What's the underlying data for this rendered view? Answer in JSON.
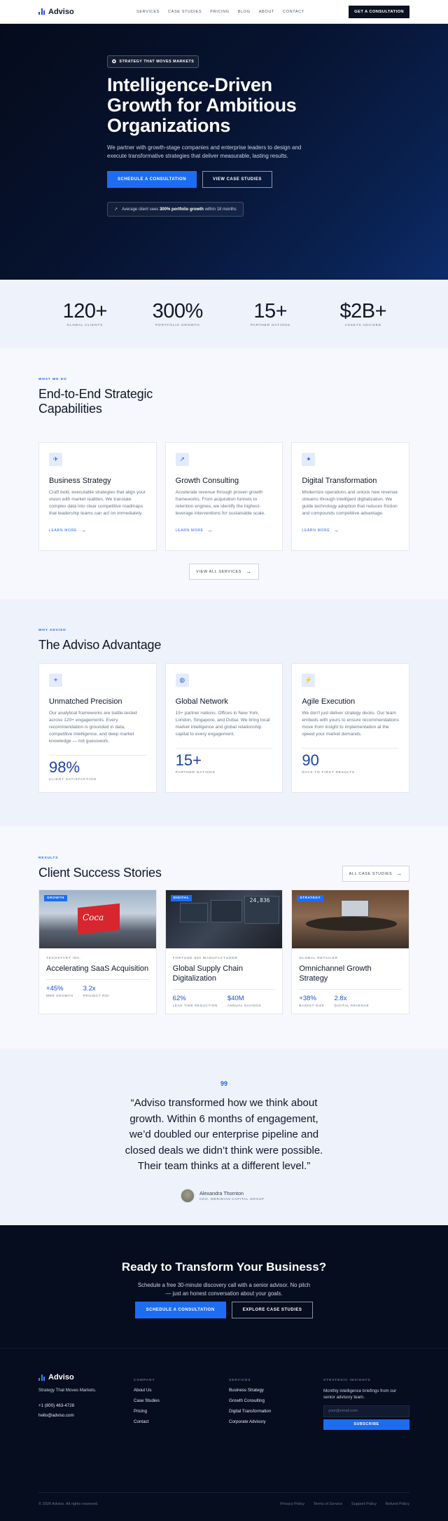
{
  "nav": {
    "brand": "Adviso",
    "links": [
      "SERVICES",
      "CASE STUDIES",
      "PRICING",
      "BLOG",
      "ABOUT",
      "CONTACT"
    ],
    "cta": "GET A CONSULTATION"
  },
  "hero": {
    "eyebrow": "STRATEGY THAT MOVES MARKETS",
    "title": "Intelligence-Driven Growth for Ambitious Organizations",
    "subtitle": "We partner with growth-stage companies and enterprise leaders to design and execute transformative strategies that deliver measurable, lasting results.",
    "primary_cta": "SCHEDULE A CONSULTATION",
    "secondary_cta": "VIEW CASE STUDIES",
    "note_prefix": "Average client sees ",
    "note_bold": "300% portfolio growth",
    "note_suffix": " within 18 months"
  },
  "stats": [
    {
      "value": "120+",
      "label": "GLOBAL CLIENTS"
    },
    {
      "value": "300%",
      "label": "PORTFOLIO GROWTH"
    },
    {
      "value": "15+",
      "label": "PARTNER NATIONS"
    },
    {
      "value": "$2B+",
      "label": "ASSETS ADVISED"
    }
  ],
  "services": {
    "eyebrow": "WHAT WE DO",
    "title": "End-to-End Strategic Capabilities",
    "cards": [
      {
        "icon": "rocket-icon",
        "title": "Business Strategy",
        "text": "Craft bold, executable strategies that align your vision with market realities. We translate complex data into clear competitive roadmaps that leadership teams can act on immediately.",
        "link": "LEARN MORE"
      },
      {
        "icon": "trend-icon",
        "title": "Growth Consulting",
        "text": "Accelerate revenue through proven growth frameworks. From acquisition funnels to retention engines, we identify the highest-leverage interventions for sustainable scale.",
        "link": "LEARN MORE"
      },
      {
        "icon": "sparkle-icon",
        "title": "Digital Transformation",
        "text": "Modernize operations and unlock new revenue streams through intelligent digitalization. We guide technology adoption that reduces friction and compounds competitive advantage.",
        "link": "LEARN MORE"
      }
    ],
    "view_all": "VIEW ALL SERVICES"
  },
  "advantage": {
    "eyebrow": "WHY ADVISO",
    "title": "The Adviso Advantage",
    "cards": [
      {
        "icon": "target-icon",
        "title": "Unmatched Precision",
        "text": "Our analytical frameworks are battle-tested across 120+ engagements. Every recommendation is grounded in data, competitive intelligence, and deep market knowledge — not guesswork.",
        "stat": "98%",
        "stat_label": "CLIENT SATISFACTION"
      },
      {
        "icon": "globe-icon",
        "title": "Global Network",
        "text": "15+ partner nations. Offices in New York, London, Singapore, and Dubai. We bring local market intelligence and global relationship capital to every engagement.",
        "stat": "15+",
        "stat_label": "PARTNER NATIONS"
      },
      {
        "icon": "bolt-icon",
        "title": "Agile Execution",
        "text": "We don't just deliver strategy decks. Our team embeds with yours to ensure recommendations move from insight to implementation at the speed your market demands.",
        "stat": "90",
        "stat_label": "DAYS TO FIRST RESULTS"
      }
    ]
  },
  "results": {
    "eyebrow": "RESULTS",
    "title": "Client Success Stories",
    "all_link": "ALL CASE STUDIES",
    "cards": [
      {
        "tag": "GROWTH",
        "client": "TECHSTART INC.",
        "title": "Accelerating SaaS Acquisition",
        "m1v": "+45%",
        "m1l": "MRR GROWTH",
        "m2v": "3.2x",
        "m2l": "PROJECT ROI",
        "sign": "Coca"
      },
      {
        "tag": "DIGITAL",
        "client": "FORTUNE 500 MANUFACTURER",
        "title": "Global Supply Chain Digitalization",
        "m1v": "62%",
        "m1l": "LEAD TIME REDUCTION",
        "m2v": "$40M",
        "m2l": "ANNUAL SAVINGS",
        "sign": "24,836"
      },
      {
        "tag": "STRATEGY",
        "client": "GLOBAL RETAILER",
        "title": "Omnichannel Growth Strategy",
        "m1v": "+38%",
        "m1l": "BASKET SIZE",
        "m2v": "2.8x",
        "m2l": "DIGITAL REVENUE",
        "sign": ""
      }
    ]
  },
  "testimonial": {
    "mark": "99",
    "quote": "“Adviso transformed how we think about growth. Within 6 months of engagement, we’d doubled our enterprise pipeline and closed deals we didn’t think were possible. Their team thinks at a different level.”",
    "name": "Alexandra Thornton",
    "role": "CEO, MERIDIAN CAPITAL GROUP"
  },
  "cta": {
    "title": "Ready to Transform Your Business?",
    "text": "Schedule a free 30-minute discovery call with a senior advisor. No pitch — just an honest conversation about your goals.",
    "primary": "SCHEDULE A CONSULTATION",
    "secondary": "EXPLORE CASE STUDIES"
  },
  "footer": {
    "brand": "Adviso",
    "tagline": "Strategy That Moves Markets.",
    "phone": "+1 (800) 463-4728",
    "email": "hello@adviso.com",
    "company_title": "COMPANY",
    "company_links": [
      "About Us",
      "Case Studies",
      "Pricing",
      "Contact"
    ],
    "services_title": "SERVICES",
    "services_links": [
      "Business Strategy",
      "Growth Consulting",
      "Digital Transformation",
      "Corporate Advisory"
    ],
    "news_title": "STRATEGIC INSIGHTS",
    "news_text": "Monthly intelligence briefings from our senior advisory team.",
    "news_placeholder": "your@email.com",
    "news_button": "SUBSCRIBE",
    "copyright": "© 2026 Adviso. All rights reserved.",
    "legal": [
      "Privacy Policy",
      "Terms of Service",
      "Support Policy",
      "Refund Policy"
    ]
  },
  "colors": {
    "accent": "#1d6df2",
    "navy": "#060d1f",
    "light_bg": "#eef2fb"
  }
}
